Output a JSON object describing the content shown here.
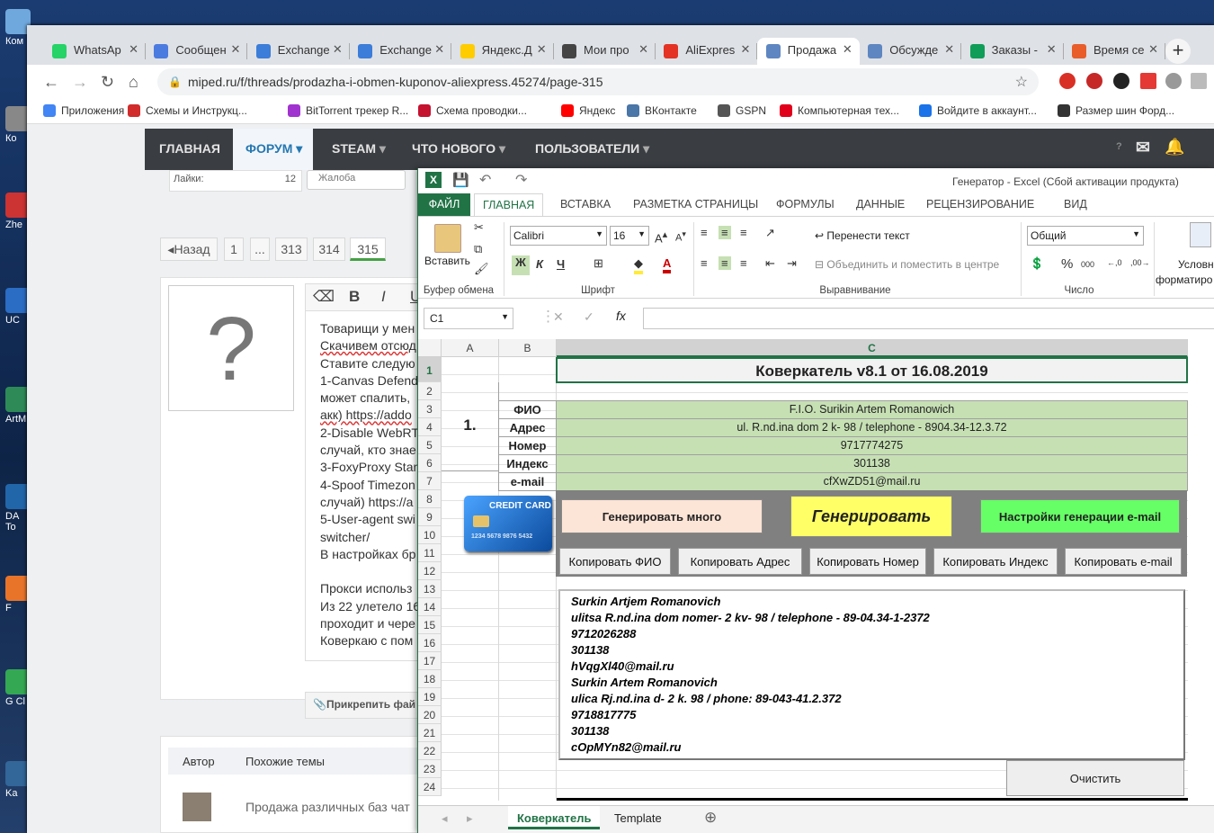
{
  "desktop": {
    "icons": [
      {
        "label": "Ком"
      },
      {
        "label": "Ко"
      },
      {
        "label": "Zhe"
      },
      {
        "label": "UC"
      },
      {
        "label": "ArtM"
      },
      {
        "label": "DA To"
      },
      {
        "label": "F"
      },
      {
        "label": "G Cl"
      },
      {
        "label": "Ka"
      }
    ]
  },
  "browser": {
    "tabs": [
      {
        "title": "WhatsAp",
        "color": "#25d366"
      },
      {
        "title": "Сообщен",
        "color": "#4c7be0"
      },
      {
        "title": "Exchange",
        "color": "#3b7dd8"
      },
      {
        "title": "Exchange",
        "color": "#3b7dd8"
      },
      {
        "title": "Яндекс.Д",
        "color": "#ffcc00"
      },
      {
        "title": "Мои про",
        "color": "#444444"
      },
      {
        "title": "AliExpres",
        "color": "#e43225"
      },
      {
        "title": "Продажа",
        "color": "#5e86c1"
      },
      {
        "title": "Обсужде",
        "color": "#5e86c1"
      },
      {
        "title": "Заказы -",
        "color": "#0f9d58"
      },
      {
        "title": "Время се",
        "color": "#e85d2a"
      }
    ],
    "active_tab_index": 7,
    "url": "miped.ru/f/threads/prodazha-i-obmen-kuponov-aliexpress.45274/page-315",
    "bookmarks": [
      {
        "label": "Приложения",
        "color": "#4285f4"
      },
      {
        "label": "Схемы и Инструкц...",
        "color": "#d12b2b"
      },
      {
        "label": "BitTorrent трекер R...",
        "color": "#a033d0"
      },
      {
        "label": "Схема проводки...",
        "color": "#c4122f"
      },
      {
        "label": "Яндекс",
        "color": "#ff0000"
      },
      {
        "label": "ВКонтакте",
        "color": "#4a76a8"
      },
      {
        "label": "GSPN",
        "color": "#555555"
      },
      {
        "label": "Компьютерная тех...",
        "color": "#e0001b"
      },
      {
        "label": "Войдите в аккаунт...",
        "color": "#1a73e8"
      },
      {
        "label": "Размер шин Форд...",
        "color": "#333333"
      }
    ]
  },
  "forum": {
    "nav": {
      "home": "ГЛАВНАЯ",
      "forum": "ФОРУМ",
      "steam": "STEAM",
      "whatsnew": "ЧТО НОВОГО",
      "users": "ПОЛЬЗОВАТЕЛИ",
      "help": "?"
    },
    "likes_label": "Лайки:",
    "likes_value": "12",
    "complaint": "Жалоба",
    "pagination": {
      "back": "◂Назад",
      "pages": [
        "1",
        "...",
        "313",
        "314",
        "315"
      ]
    },
    "avatar_glyph": "?",
    "editor_text": [
      "Товарищи у мен",
      "Скачивем отсюд",
      "Ставите следую",
      "1-Canvas Defend",
      "может спалить,",
      "акк) https://addo",
      "2-Disable WebRT",
      "случай, кто знае",
      "3-FoxyProxy Stan",
      "4-Spoof Timezon",
      "случай) https://a",
      "5-User-agent swi",
      "switcher/",
      "В настройках бр",
      "",
      "Прокси использ",
      "Из 22 улетело 16",
      "проходит и чере",
      "Коверкаю с пом"
    ],
    "attach": "Прикрепить фай",
    "similar": {
      "author_header": "Автор",
      "topics_header": "Похожие темы",
      "row": "Продажа различных баз чат"
    }
  },
  "excel": {
    "title": "Генератор - Excel (Сбой активации продукта)",
    "ribbon_tabs": [
      "ФАЙЛ",
      "ГЛАВНАЯ",
      "ВСТАВКА",
      "РАЗМЕТКА СТРАНИЦЫ",
      "ФОРМУЛЫ",
      "ДАННЫЕ",
      "РЕЦЕНЗИРОВАНИЕ",
      "ВИД"
    ],
    "paste": "Вставить",
    "groups": {
      "clipboard": "Буфер обмена",
      "font": "Шрифт",
      "align": "Выравнивание",
      "number": "Число"
    },
    "font_name": "Calibri",
    "font_size": "16",
    "wrap": "Перенести текст",
    "merge": "Объединить и поместить в центре",
    "number_format": "Общий",
    "cond": "Условн",
    "cond2": "форматиро",
    "name_box": "C1",
    "columns": [
      "A",
      "B",
      "C"
    ],
    "rows": [
      "1",
      "2",
      "3",
      "4",
      "5",
      "6",
      "7",
      "8",
      "9",
      "10",
      "11",
      "12",
      "13",
      "14",
      "15",
      "16",
      "17",
      "18",
      "19",
      "20",
      "21",
      "22",
      "23",
      "24"
    ],
    "header_title": "Коверкатель v8.1 от 16.08.2019",
    "block_number": "1.",
    "fields": [
      {
        "label": "ФИО",
        "value": "F.I.O. Surikin Artem Romanowich"
      },
      {
        "label": "Адрес",
        "value": "ul. R.nd.ina   dom 2 k- 98 / telephone - 8904.34-12.3.72"
      },
      {
        "label": "Номер",
        "value": "9717774275"
      },
      {
        "label": "Индекс",
        "value": "301138"
      },
      {
        "label": "e-mail",
        "value": "cfXwZD51@mail.ru"
      }
    ],
    "card_text": "CREDIT CARD",
    "card_number": "1234 5678 9876 5432",
    "buttons": {
      "gen_many": "Генерировать много",
      "gen": "Генерировать",
      "email_settings": "Настройки генерации e-mail"
    },
    "copy_buttons": [
      "Копировать ФИО",
      "Копировать Адрес",
      "Копировать Номер",
      "Копировать Индекс",
      "Копировать e-mail"
    ],
    "output": [
      "Surkin Artjem Romanovich",
      "ulitsa R.nd.ina   dom nomer- 2 kv- 98 / telephone - 89-04.34-1-2372",
      "9712026288",
      "301138",
      "hVqgXl40@mail.ru",
      "Surkin Artem Romanovich",
      "ulica Rj.nd.ina   d- 2 k. 98 / phone: 89-043-41.2.372",
      "9718817775",
      "301138",
      "cOpMYn82@mail.ru"
    ],
    "clear": "Очистить",
    "sheets": [
      "Коверкатель",
      "Template"
    ]
  }
}
